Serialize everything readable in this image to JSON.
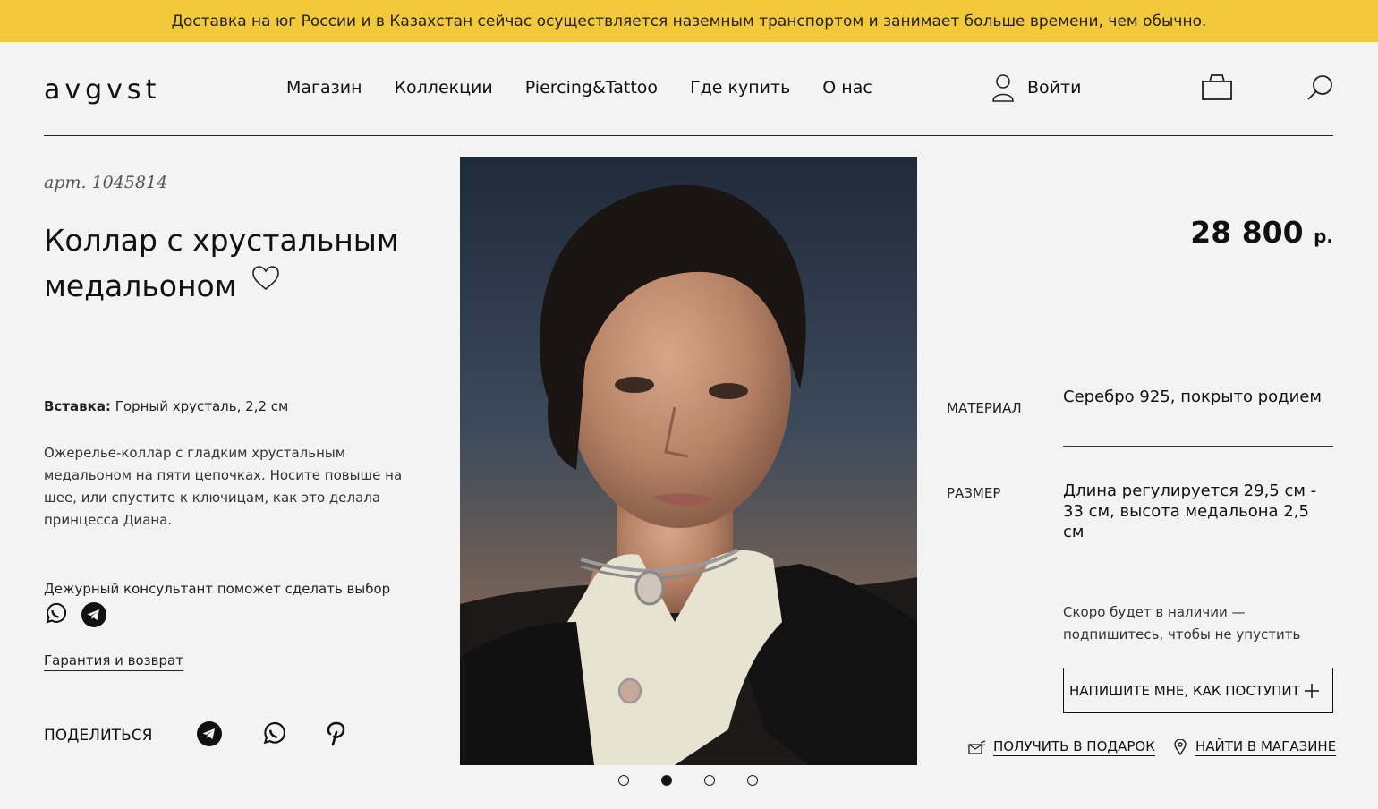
{
  "banner": {
    "text": "Доставка на юг России и в Казахстан сейчас осуществляется наземным транспортом и занимает больше времени, чем обычно."
  },
  "header": {
    "logo": "avgvst",
    "nav": [
      "Магазин",
      "Коллекции",
      "Piercing&Tattoo",
      "Где купить",
      "О нас"
    ],
    "login_label": "Войти"
  },
  "product": {
    "article": "арт. 1045814",
    "title": "Коллар с хрустальным медальоном",
    "insert_label": "Вставка:",
    "insert_value": "Горный хрусталь, 2,2 см",
    "description": "Ожерелье-коллар с гладким хрустальным медальоном на пяти цепочках. Носите повыше на шее, или спустите к ключицам, как это делала принцесса Диана.",
    "consult_text": "Дежурный консультант поможет сделать выбор",
    "warranty_link": "Гарантия и возврат",
    "share_label": "ПОДЕЛИТЬСЯ",
    "price": "28 800",
    "currency": "р.",
    "specs": [
      {
        "label": "МАТЕРИАЛ",
        "value": "Серебро 925, покрыто родием"
      },
      {
        "label": "РАЗМЕР",
        "value": "Длина регулируется 29,5 см - 33 см, высота медальона 2,5 см"
      }
    ],
    "availability": "Скоро будет в наличии — подпишитесь, чтобы не упустить",
    "notify_button": "НАПИШИТЕ МНЕ, КАК ПОСТУПИТ",
    "gift_link": "ПОЛУЧИТЬ В ПОДАРОК",
    "store_link": "НАЙТИ В МАГАЗИНЕ"
  },
  "gallery": {
    "slides": 4,
    "active_slide": 2
  },
  "colors": {
    "banner": "#f3c93c",
    "background": "#f3f3f3",
    "text": "#111111"
  },
  "icons": [
    "user-icon",
    "bag-icon",
    "search-icon",
    "heart-icon",
    "whatsapp-icon",
    "telegram-icon",
    "pinterest-icon",
    "gift-icon",
    "location-pin-icon",
    "plus-icon"
  ]
}
